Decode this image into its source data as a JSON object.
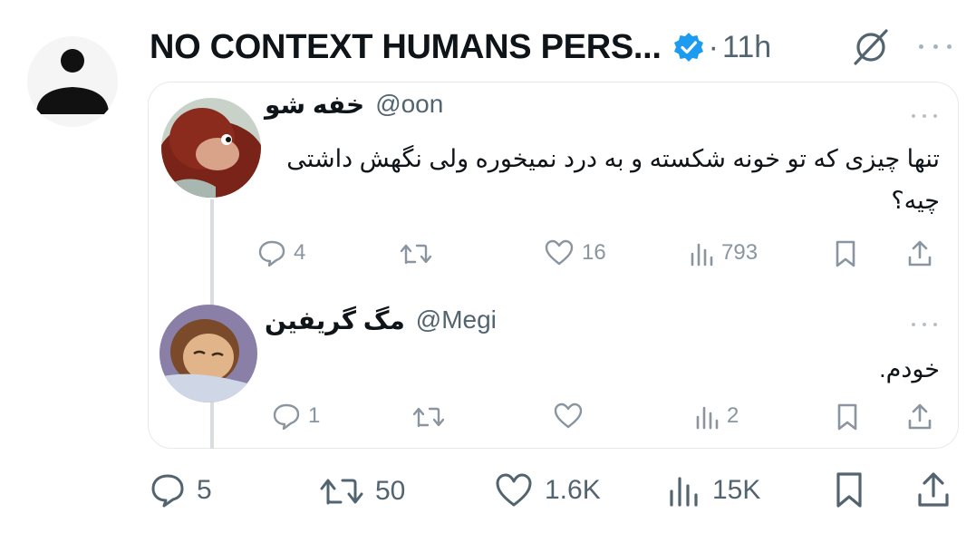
{
  "post": {
    "display_name": "NO CONTEXT HUMANS PERS...",
    "separator": "·",
    "time": "11h",
    "icons": {
      "avatar": "default-person-icon",
      "verified": "verified-badge-icon",
      "grok": "grok-icon",
      "more": "more-dots-icon"
    },
    "colors": {
      "verified": "#1d9bf0",
      "text": "#0f1419",
      "muted": "#536471"
    },
    "actions": {
      "replies": "5",
      "reposts": "50",
      "likes": "1.6K",
      "views": "15K"
    }
  },
  "quote": {
    "first": {
      "name": "خفه شو",
      "handle": "@oon",
      "text": "تنها چیزی که تو خونه شکسته و به درد نمیخوره ولی نگهش داشتی چیه؟",
      "replies": "4",
      "reposts": "",
      "likes": "16",
      "views": "793"
    },
    "second": {
      "name": "مگ گریفین",
      "handle": "@Megi",
      "text": "خودم.",
      "replies": "1",
      "reposts": "",
      "likes": "",
      "views": "2"
    }
  }
}
